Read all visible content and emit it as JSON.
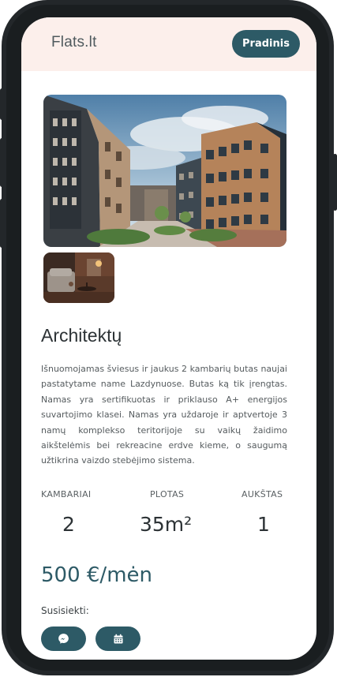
{
  "header": {
    "brand": "Flats.lt",
    "home_button": "Pradinis"
  },
  "gallery": {
    "main_image": "apartment-building-exterior",
    "thumbnail": "apartment-interior-living-room"
  },
  "listing": {
    "title": "Architektų",
    "description": "Išnuomojamas šviesus ir jaukus 2 kambarių butas naujai pastatytame name Lazdynuose. Butas ką tik įrengtas. Namas yra sertifikuotas ir priklauso A+ energijos suvartojimo klasei. Namas yra uždaroje ir aptvertoje 3 namų komplekso teritorijoje su vaikų žaidimo aikštelėmis bei rekreacine erdve kieme, o saugumą užtikrina vaizdo stebėjimo sistema.",
    "stats": [
      {
        "label": "KAMBARIAI",
        "value": "2"
      },
      {
        "label": "PLOTAS",
        "value": "35m²"
      },
      {
        "label": "AUKŠTAS",
        "value": "1"
      }
    ],
    "price": "500 €/mėn"
  },
  "contact": {
    "label": "Susisiekti:",
    "buttons": [
      "messenger-icon",
      "calendar-icon"
    ]
  },
  "colors": {
    "accent": "#2d5a66",
    "header_bg": "#fcefeb",
    "frame": "#23272a"
  }
}
